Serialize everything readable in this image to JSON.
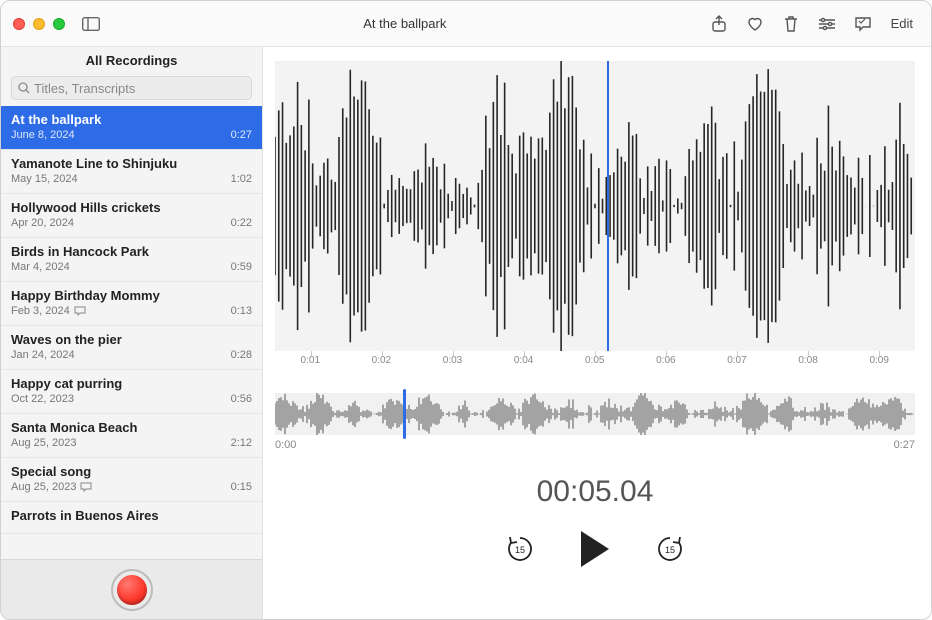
{
  "window": {
    "title": "At the ballpark",
    "edit_label": "Edit"
  },
  "sidebar": {
    "title": "All Recordings",
    "search_placeholder": "Titles, Transcripts",
    "items": [
      {
        "name": "At the ballpark",
        "date": "June 8, 2024",
        "duration": "0:27",
        "selected": true,
        "has_transcript": false
      },
      {
        "name": "Yamanote Line to Shinjuku",
        "date": "May 15, 2024",
        "duration": "1:02",
        "selected": false,
        "has_transcript": false
      },
      {
        "name": "Hollywood Hills crickets",
        "date": "Apr 20, 2024",
        "duration": "0:22",
        "selected": false,
        "has_transcript": false
      },
      {
        "name": "Birds in Hancock Park",
        "date": "Mar 4, 2024",
        "duration": "0:59",
        "selected": false,
        "has_transcript": false
      },
      {
        "name": "Happy Birthday Mommy",
        "date": "Feb 3, 2024",
        "duration": "0:13",
        "selected": false,
        "has_transcript": true
      },
      {
        "name": "Waves on the pier",
        "date": "Jan 24, 2024",
        "duration": "0:28",
        "selected": false,
        "has_transcript": false
      },
      {
        "name": "Happy cat purring",
        "date": "Oct 22, 2023",
        "duration": "0:56",
        "selected": false,
        "has_transcript": false
      },
      {
        "name": "Santa Monica Beach",
        "date": "Aug 25, 2023",
        "duration": "2:12",
        "selected": false,
        "has_transcript": false
      },
      {
        "name": "Special song",
        "date": "Aug 25, 2023",
        "duration": "0:15",
        "selected": false,
        "has_transcript": true
      },
      {
        "name": "Parrots in Buenos Aires",
        "date": "",
        "duration": "",
        "selected": false,
        "has_transcript": false
      }
    ]
  },
  "ruler": {
    "ticks": [
      "0:01",
      "0:02",
      "0:03",
      "0:04",
      "0:05",
      "0:06",
      "0:07",
      "0:08",
      "0:09"
    ]
  },
  "overview": {
    "start": "0:00",
    "end": "0:27"
  },
  "playback": {
    "timecode": "00:05.04",
    "skip_seconds": "15",
    "playhead_percent_big": 52,
    "playhead_percent_overview": 20
  },
  "icons": {
    "sidebar_toggle": "sidebar-toggle-icon",
    "share": "share-icon",
    "favorite": "heart-icon",
    "delete": "trash-icon",
    "settings": "sliders-icon",
    "transcript": "speech-bubble-icon"
  }
}
